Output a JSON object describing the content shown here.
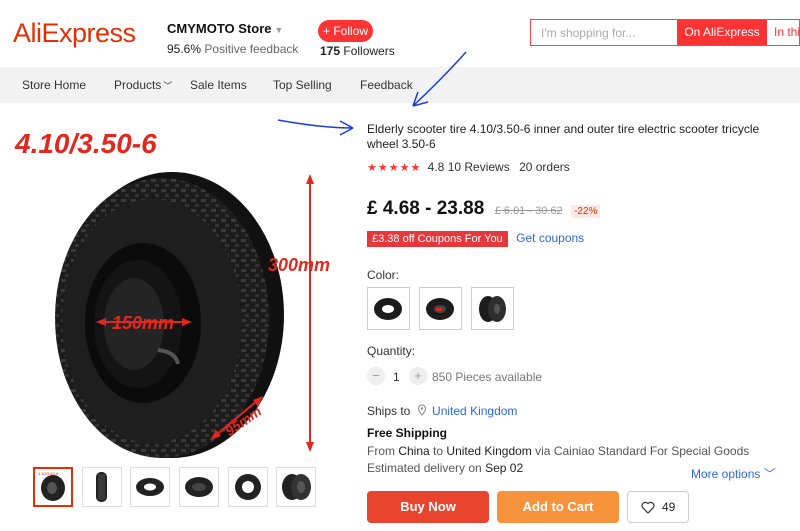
{
  "header": {
    "logo": "AliExpress",
    "store_name": "CMYMOTO Store",
    "positive_pct": "95.6%",
    "positive_label": "Positive feedback",
    "follow_label": "+ Follow",
    "followers_count": "175",
    "followers_label": "Followers",
    "search_placeholder": "I'm shopping for...",
    "search_ali": "On AliExpress",
    "search_store": "In thi"
  },
  "nav": {
    "items": [
      "Store Home",
      "Products",
      "Sale Items",
      "Top Selling",
      "Feedback"
    ]
  },
  "image": {
    "size_title": "4.10/3.50-6",
    "dim_height": "300mm",
    "dim_inner": "150mm",
    "dim_width": "95mm"
  },
  "product": {
    "title": "Elderly scooter tire 4.10/3.50-6 inner and outer tire electric scooter tricycle wheel 3.50-6",
    "rating": "4.8",
    "rating_stars": 5,
    "reviews": "10 Reviews",
    "orders": "20 orders",
    "price": "£ 4.68 - 23.88",
    "old_price": "£ 6.01 - 30.62",
    "discount": "-22%",
    "coupon": "£3.38 off Coupons For You",
    "get_coupons": "Get coupons",
    "color_label": "Color:",
    "quantity_label": "Quantity:",
    "quantity_value": "1",
    "pieces_available": "850 Pieces available",
    "ships_to_label": "Ships to",
    "ships_to_country": "United Kingdom",
    "free_shipping": "Free Shipping",
    "from_prefix": "From",
    "from_country": "China",
    "to_prefix": "to",
    "to_country": "United Kingdom",
    "via_text": "via Cainiao Standard For Special Goods",
    "est_prefix": "Estimated delivery on",
    "est_date": "Sep 02",
    "more_options": "More options",
    "buy_now": "Buy Now",
    "add_to_cart": "Add to Cart",
    "wishlist_count": "49"
  },
  "colors": {
    "brand": "#e62e04",
    "accent_red": "#f33333",
    "link_blue": "#2a6ad8",
    "buy_btn": "#e9452e",
    "cart_btn": "#f7933a",
    "annotation": "#1a3fd8"
  }
}
